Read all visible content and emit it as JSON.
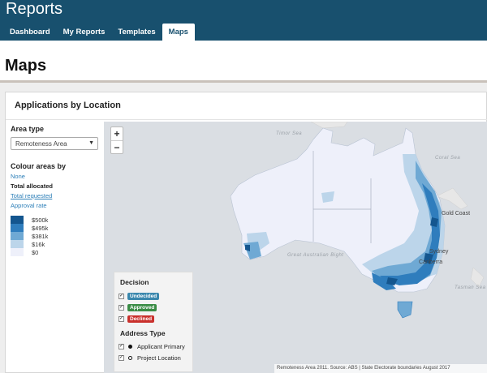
{
  "app": {
    "title": "Reports"
  },
  "nav": {
    "tabs": [
      "Dashboard",
      "My Reports",
      "Templates",
      "Maps"
    ],
    "active": "Maps"
  },
  "page": {
    "title": "Maps"
  },
  "card": {
    "title": "Applications by Location"
  },
  "sidebar": {
    "area_type_label": "Area type",
    "area_type_value": "Remoteness Area",
    "colour_label": "Colour areas by",
    "options": [
      "None",
      "Total allocated",
      "Total requested",
      "Approval rate"
    ]
  },
  "legend": {
    "items": [
      {
        "label": "$500k",
        "color": "#14568f"
      },
      {
        "label": "$495k",
        "color": "#2f7dbd"
      },
      {
        "label": "$381k",
        "color": "#6fa9d4"
      },
      {
        "label": "$16k",
        "color": "#bcd5ea"
      },
      {
        "label": "$0",
        "color": "#eef0fa"
      }
    ]
  },
  "map": {
    "zoom_in": "+",
    "zoom_out": "−",
    "labels": {
      "timor_sea": "Timor Sea",
      "coral_sea": "Coral Sea",
      "great_australian_bight": "Great Australian Bight",
      "tasman_sea": "Tasman Sea",
      "gold_coast": "Gold Coast",
      "sydney": "Sydney",
      "canberra": "Canberra"
    },
    "attribution": "Remoteness Area 2011. Source: ABS | State Electorate boundaries August 2017"
  },
  "decision": {
    "title": "Decision",
    "items": [
      {
        "label": "Undecided",
        "color": "#3a87ad"
      },
      {
        "label": "Approved",
        "color": "#3a8c45"
      },
      {
        "label": "Declined",
        "color": "#c9302c"
      }
    ],
    "address_title": "Address Type",
    "address_items": [
      "Applicant Primary",
      "Project Location"
    ]
  }
}
